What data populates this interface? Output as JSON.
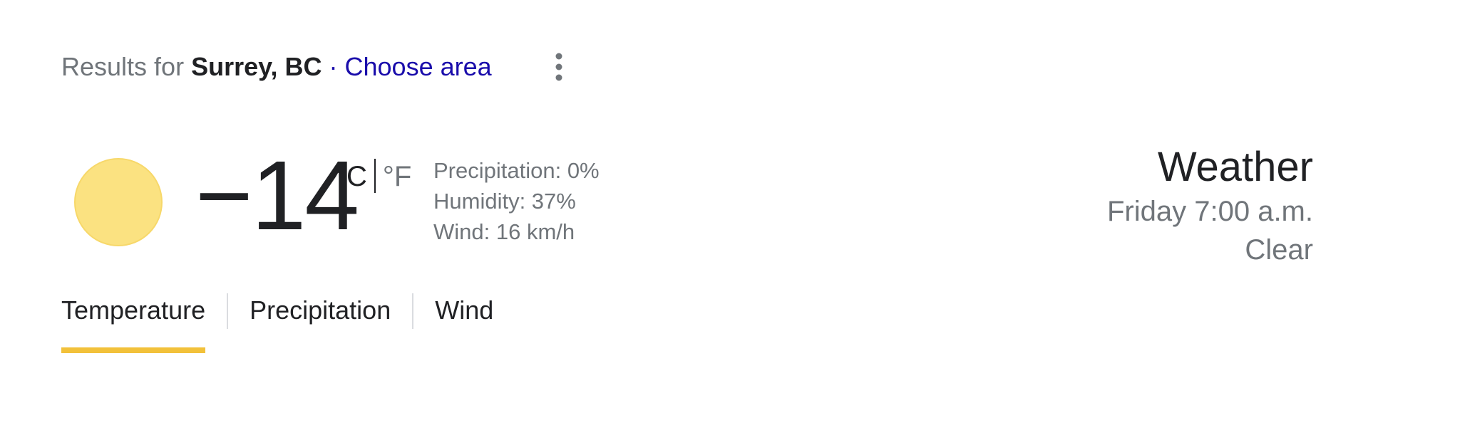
{
  "header": {
    "results_prefix": "Results for",
    "location": "Surrey, BC",
    "separator": "·",
    "choose_area": "Choose area",
    "more_icon": "more-vert-icon"
  },
  "current": {
    "condition_icon": "sun-icon",
    "temperature": "-14",
    "unit_c": "°C",
    "unit_f": "°F",
    "active_unit": "°C",
    "precipitation": "Precipitation: 0%",
    "humidity": "Humidity: 37%",
    "wind": "Wind: 16 km/h"
  },
  "summary": {
    "title": "Weather",
    "datetime": "Friday 7:00 a.m.",
    "condition": "Clear"
  },
  "tabs": [
    {
      "label": "Temperature",
      "active": true
    },
    {
      "label": "Precipitation",
      "active": false
    },
    {
      "label": "Wind",
      "active": false
    }
  ],
  "colors": {
    "sun": "#fbe281",
    "active_tab_underline": "#f2c13a",
    "link": "#1a0dab",
    "muted_text": "#70757a",
    "primary_text": "#202124"
  }
}
